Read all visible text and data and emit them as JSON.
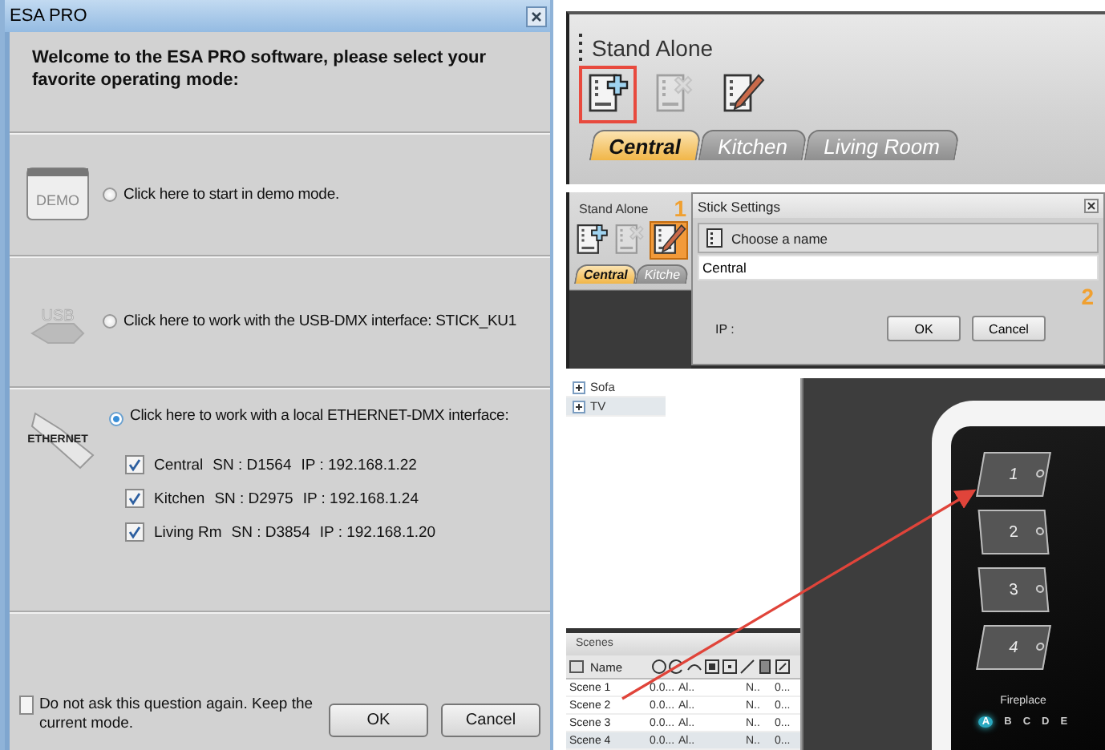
{
  "esa_dialog": {
    "title": "ESA PRO",
    "heading": "Welcome to the ESA PRO software, please select your favorite operating mode:",
    "modes": [
      {
        "kind": "demo",
        "icon_text": "DEMO",
        "label": "Click here to start in demo mode.",
        "selected": false
      },
      {
        "kind": "usb",
        "icon_text": "USB",
        "label": "Click here to work with the USB-DMX interface:  STICK_KU1",
        "selected": false
      },
      {
        "kind": "ethernet",
        "icon_text": "ETHERNET",
        "label": "Click here to work with a local ETHERNET-DMX interface:",
        "selected": true,
        "devices": [
          {
            "name": "Central",
            "serial": "SN : D1564",
            "ip": "IP : 192.168.1.22",
            "checked": true
          },
          {
            "name": "Kitchen",
            "serial": "SN : D2975",
            "ip": "IP : 192.168.1.24",
            "checked": true
          },
          {
            "name": "Living Rm",
            "serial": "SN : D3854",
            "ip": "IP : 192.168.1.20",
            "checked": true
          }
        ]
      }
    ],
    "remember": {
      "label": "Do not ask this question again. Keep the current mode.",
      "checked": false
    },
    "buttons": [
      "OK",
      "Cancel"
    ]
  },
  "stand_alone": {
    "title": "Stand Alone",
    "tools": [
      {
        "kind": "add",
        "highlighted": true,
        "disabled": false
      },
      {
        "kind": "delete",
        "highlighted": false,
        "disabled": true
      },
      {
        "kind": "edit",
        "highlighted": false,
        "disabled": false
      }
    ],
    "tabs": [
      {
        "label": "Central",
        "selected": true
      },
      {
        "label": "Kitchen",
        "selected": false
      },
      {
        "label": "Living Room",
        "selected": false
      }
    ]
  },
  "stick_settings_step": {
    "panel_title": "Stand Alone",
    "step_1": "1",
    "tools": [
      {
        "kind": "add",
        "highlighted": false,
        "disabled": false
      },
      {
        "kind": "delete",
        "highlighted": false,
        "disabled": true
      },
      {
        "kind": "edit",
        "highlighted": true,
        "disabled": false
      }
    ],
    "tabs": [
      {
        "label": "Central",
        "selected": true
      },
      {
        "label": "Kitche",
        "selected": false
      }
    ],
    "dialog": {
      "title": "Stick Settings",
      "section": "Choose a name",
      "name_value": "Central",
      "step_2": "2",
      "ip_label": "IP :",
      "buttons": [
        "OK",
        "Cancel"
      ]
    }
  },
  "tree": {
    "items": [
      {
        "label": "Sofa",
        "selected": false
      },
      {
        "label": "TV",
        "selected": true
      }
    ]
  },
  "scenes": {
    "title": "Scenes",
    "name_column": "Name",
    "rows": [
      {
        "name": "Scene 1",
        "cells": [
          "0.0...",
          "Al..",
          "N..",
          "0..."
        ],
        "selected": false
      },
      {
        "name": "Scene 2",
        "cells": [
          "0.0...",
          "Al..",
          "N..",
          "0..."
        ],
        "selected": false
      },
      {
        "name": "Scene 3",
        "cells": [
          "0.0...",
          "Al..",
          "N..",
          "0..."
        ],
        "selected": false
      },
      {
        "name": "Scene 4",
        "cells": [
          "0.0...",
          "Al..",
          "N..",
          "0..."
        ],
        "selected": true
      }
    ]
  },
  "keypad": {
    "buttons": [
      "1",
      "2",
      "3",
      "4"
    ],
    "label": "Fireplace",
    "pages": [
      {
        "label": "A",
        "selected": true
      },
      {
        "label": "B",
        "selected": false
      },
      {
        "label": "C",
        "selected": false
      },
      {
        "label": "D",
        "selected": false
      },
      {
        "label": "E",
        "selected": false
      }
    ]
  }
}
